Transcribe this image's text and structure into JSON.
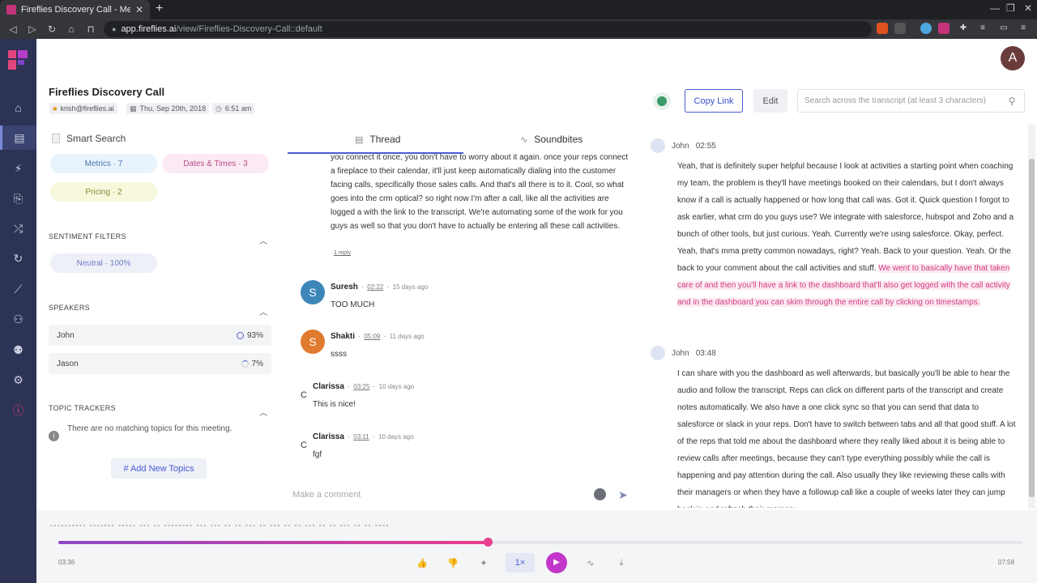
{
  "browser": {
    "tab_title": "Fireflies Discovery Call - Meeting",
    "url_host": "app.fireflies.ai",
    "url_path": "/view/Fireflies-Discovery-Call::default"
  },
  "user": {
    "avatar_letter": "A"
  },
  "meeting": {
    "title": "Fireflies Discovery Call",
    "owner": "krish@fireflies.ai",
    "date": "Thu, Sep 20th, 2018",
    "time": "6:51 am"
  },
  "header": {
    "copy_link": "Copy Link",
    "edit": "Edit",
    "search_placeholder": "Search across the transcript (at least 3 characters)"
  },
  "smart_search": {
    "title": "Smart Search",
    "chips": [
      {
        "label": "Metrics · 7",
        "bg": "#e8f3fb",
        "color": "#4a78b0"
      },
      {
        "label": "Dates & Times · 3",
        "bg": "#fbeaf3",
        "color": "#b84e8a"
      },
      {
        "label": "Pricing · 2",
        "bg": "#f7f8dc",
        "color": "#8a8a3a"
      }
    ]
  },
  "sentiment": {
    "title": "SENTIMENT FILTERS",
    "chip": "Neutral · 100%"
  },
  "speakers": {
    "title": "SPEAKERS",
    "items": [
      {
        "name": "John",
        "pct": "93%"
      },
      {
        "name": "Jason",
        "pct": "7%"
      }
    ]
  },
  "topics": {
    "title": "TOPIC TRACKERS",
    "empty": "There are no matching topics for this meeting.",
    "add": "# Add New Topics"
  },
  "tabs": {
    "thread": "Thread",
    "soundbites": "Soundbites"
  },
  "thread": {
    "text": "you connect it once, you don't have to worry about it again. once your reps connect a fireplace to their calendar, it'll just keep automatically dialing into the customer facing calls, specifically those sales calls. And that's all there is to it. Cool, so what goes into the crm optical? so right now I'm after a call, like all the activities are logged a with the link to the transcript. We're automating some of the work for you guys as well so that you don't have to actually be entering all these call activities.",
    "reply": "1 reply",
    "comments": [
      {
        "name": "Suresh",
        "time": "02:22",
        "ago": "15 days ago",
        "body": "TOO MUCH",
        "initial": "S",
        "color": "#3d87b8"
      },
      {
        "name": "Shakti",
        "time": "05:09",
        "ago": "11 days ago",
        "body": "ssss",
        "initial": "S",
        "color": "#e07a2e"
      },
      {
        "name": "Clarissa",
        "time": "03:25",
        "ago": "10 days ago",
        "body": "This is nice!",
        "initial": "C"
      },
      {
        "name": "Clarissa",
        "time": "03:11",
        "ago": "10 days ago",
        "body": "fgf",
        "initial": "C"
      }
    ],
    "comment_placeholder": "Make a comment"
  },
  "transcript": [
    {
      "speaker": "John",
      "time": "02:55",
      "text": "Yeah, that is definitely super helpful because I look at activities a starting point when coaching my team, the problem is they'll have meetings booked on their calendars, but I don't always know if a call is actually happened or how long that call was. Got it. Quick question I forgot to ask earlier, what crm do you guys use? We integrate with salesforce, hubspot and Zoho and a bunch of other tools, but just curious. Yeah. Currently we're using salesforce. Okay, perfect. Yeah, that's mma pretty common nowadays, right? Yeah. Back to your question. Yeah. Or the back to your comment about the call activities and stuff.",
      "highlight": "We went to basically have that taken care of and then you'll have a link to the dashboard that'll also get logged with the call activity and in the dashboard you can skim through the entire call by clicking on timestamps."
    },
    {
      "speaker": "John",
      "time": "03:48",
      "text": "I can share with you the dashboard as well afterwards, but basically you'll be able to hear the audio and follow the transcript. Reps can click on different parts of the transcript and create notes automatically. We also have a one click sync so that you can send that data to salesforce or slack in your reps. Don't have to switch between tabs and all that good stuff. A lot of the reps that told me about the dashboard where they really liked about it is being able to review calls after meetings, because they can't type everything possibly while the call is happening and pay attention during the call. Also usually they like reviewing these calls with their managers or when they have a followup call like a couple of weeks later they can jump back in and refresh their memory."
    }
  ],
  "player": {
    "current": "03:36",
    "total": "07:58",
    "speed": "1×",
    "progress": 0.445
  }
}
